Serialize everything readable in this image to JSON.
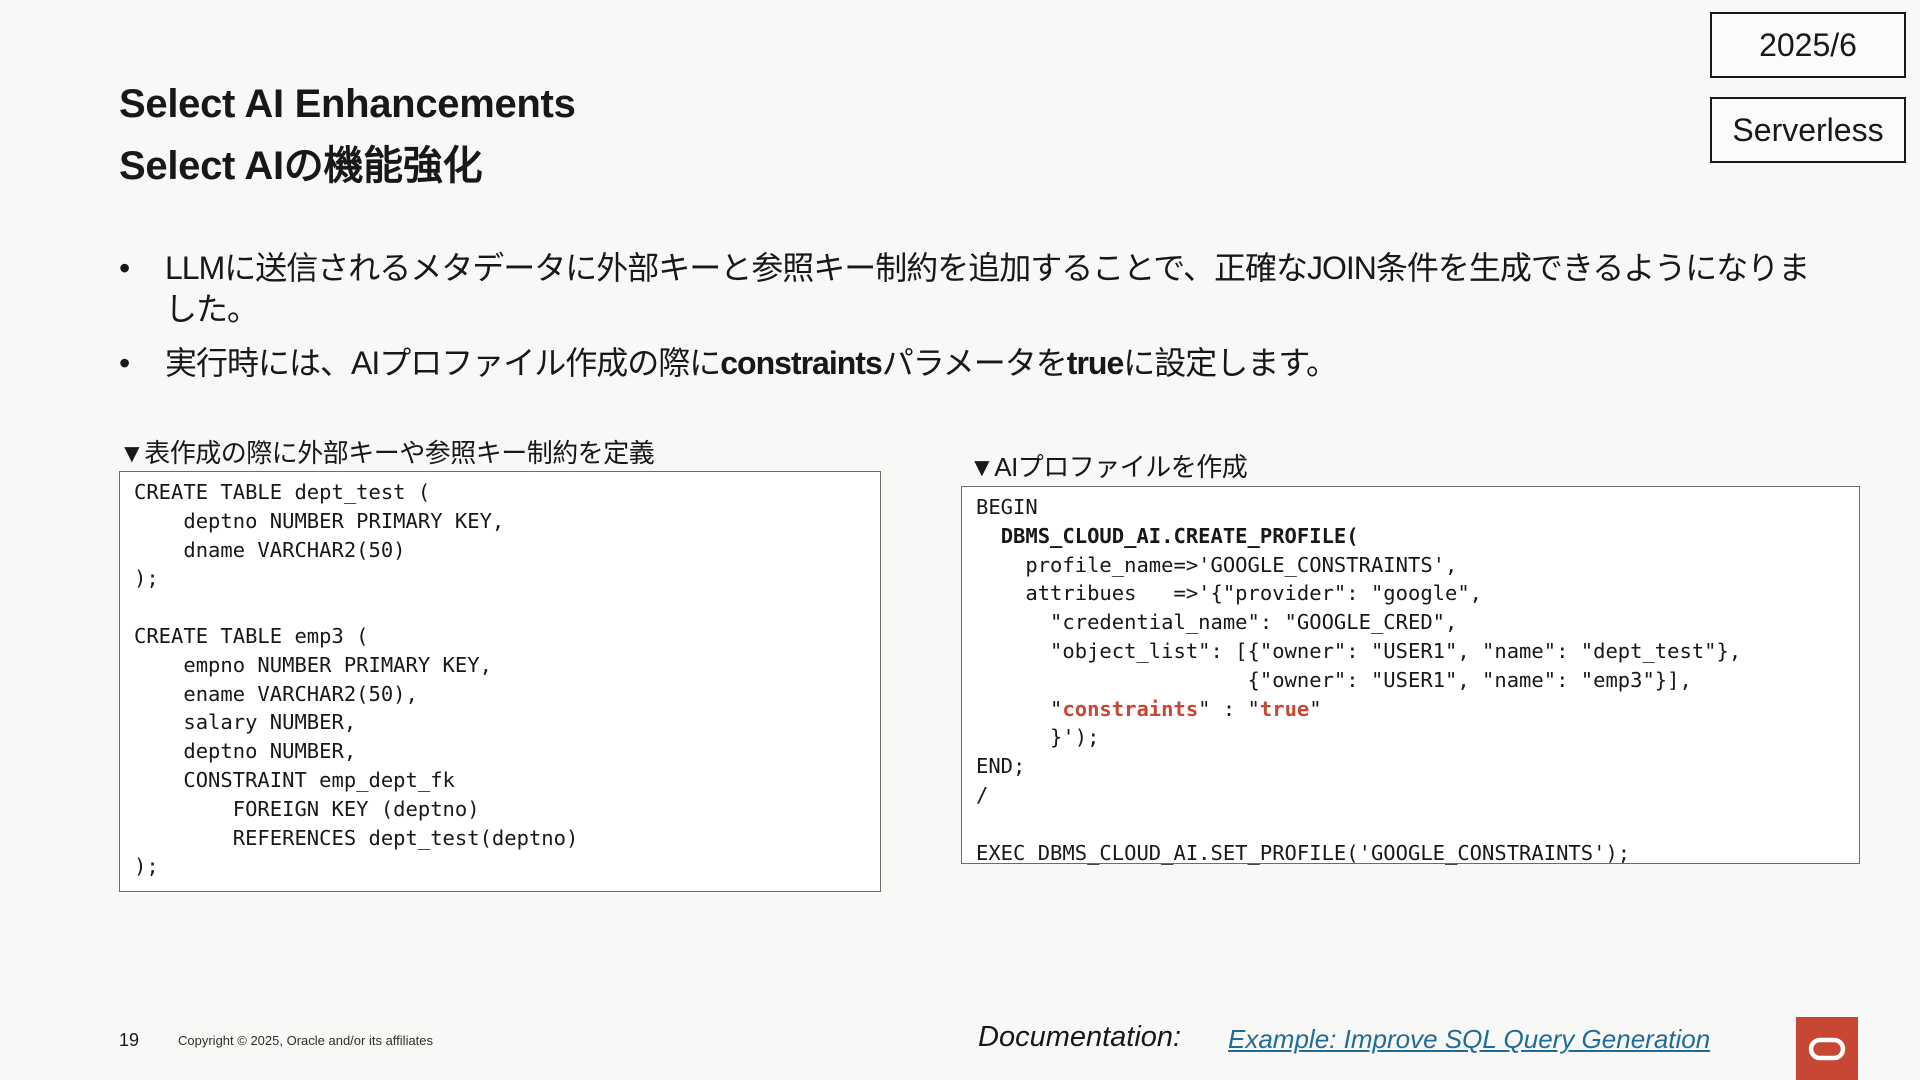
{
  "tags": {
    "date": "2025/6",
    "environment": "Serverless"
  },
  "title": {
    "en": "Select AI Enhancements",
    "ja": "Select AIの機能強化"
  },
  "bullets": {
    "dot": "•",
    "b1": "LLMに送信されるメタデータに外部キーと参照キー制約を追加することで、正確なJOIN条件を生成できるようになりました。",
    "b2_pre": "実行時には、AIプロファイル作成の際に",
    "b2_kw1": "constraints",
    "b2_mid": "パラメータを",
    "b2_kw2": "true",
    "b2_post": "に設定します。"
  },
  "captions": {
    "left": "▼表作成の際に外部キーや参照キー制約を定義",
    "right": "▼AIプロファイルを作成"
  },
  "code_left": {
    "lines": [
      "CREATE TABLE dept_test (",
      "    deptno NUMBER PRIMARY KEY,",
      "    dname VARCHAR2(50)",
      ");",
      "",
      "CREATE TABLE emp3 (",
      "    empno NUMBER PRIMARY KEY,",
      "    ename VARCHAR2(50),",
      "    salary NUMBER,",
      "    deptno NUMBER,",
      "    CONSTRAINT emp_dept_fk",
      "        FOREIGN KEY (deptno)",
      "        REFERENCES dept_test(deptno)",
      ");"
    ]
  },
  "code_right": {
    "begin": "BEGIN",
    "indent1": "  ",
    "call": "DBMS_CLOUD_AI.CREATE_PROFILE(",
    "l3": "    profile_name=>'GOOGLE_CONSTRAINTS',",
    "l4": "    attribues   =>'{\"provider\": \"google\",",
    "l5": "      \"credential_name\": \"GOOGLE_CRED\",",
    "l6": "      \"object_list\": [{\"owner\": \"USER1\", \"name\": \"dept_test\"},",
    "l7": "                      {\"owner\": \"USER1\", \"name\": \"emp3\"}],",
    "l8_pre": "      \"",
    "l8_key": "constraints",
    "l8_mid": "\" : \"",
    "l8_val": "true",
    "l8_post": "\"",
    "l9": "      }');",
    "l10": "END;",
    "l11": "/",
    "l12": "",
    "l13": "EXEC DBMS_CLOUD_AI.SET_PROFILE('GOOGLE_CONSTRAINTS');"
  },
  "footer": {
    "page_number": "19",
    "copyright": "Copyright © 2025, Oracle and/or its affiliates",
    "doc_label": "Documentation:",
    "doc_separator": " ",
    "doc_link": "Example: Improve SQL Query Generation"
  },
  "colors": {
    "accent": "#c74634",
    "link": "#1f6c99"
  },
  "icons": {
    "logo": "oracle-logo-icon"
  }
}
